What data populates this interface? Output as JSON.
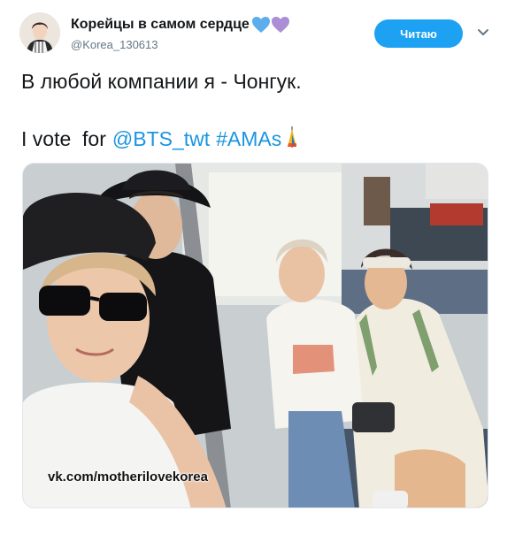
{
  "author": {
    "display_name": "Корейцы в самом сердце",
    "handle": "@Korea_130613",
    "avatar_icon": "user-avatar",
    "badge_icons": [
      "blue-heart-icon",
      "purple-heart-icon"
    ]
  },
  "actions": {
    "follow_label": "Читаю",
    "menu_icon": "chevron-down-icon"
  },
  "tweet": {
    "line1": "В любой компании я - Чонгук.",
    "line2_prefix": "I vote  for",
    "mention": "@BTS_twt",
    "hashtag": "#AMAs",
    "hashtag_icon": "ama-flag-icon"
  },
  "media": {
    "watermark": "vk.com/motherilovekorea"
  },
  "colors": {
    "link": "#1b95e0",
    "follow_button": "#1da1f2",
    "heart_blue": "#5dadec",
    "heart_purple": "#aa8ed6"
  }
}
